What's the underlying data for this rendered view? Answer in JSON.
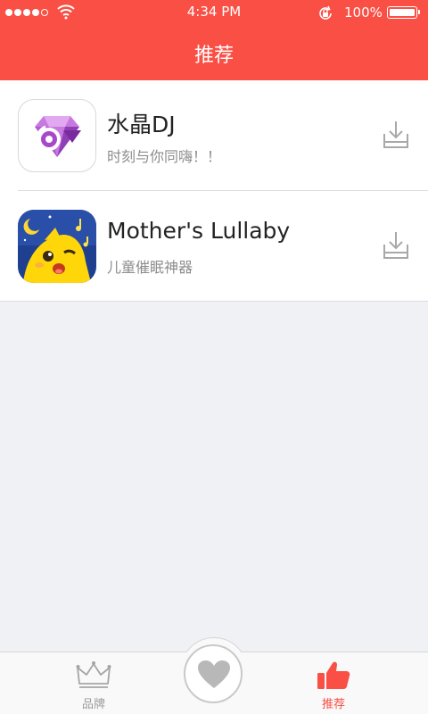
{
  "status_bar": {
    "time": "4:34 PM",
    "battery": "100%",
    "battery_level": 1.0,
    "signal_bars_filled": 4,
    "signal_bars_total": 5,
    "wifi_icon": "wifi-icon",
    "rotation_lock_icon": "rotation-lock-icon"
  },
  "nav": {
    "title": "推荐"
  },
  "apps": [
    {
      "name": "水晶DJ",
      "description": "时刻与你同嗨！！",
      "icon": "crystal-dj-icon",
      "action_icon": "download-icon"
    },
    {
      "name": "Mother's Lullaby",
      "description": "儿童催眠神器",
      "icon": "mothers-lullaby-icon",
      "action_icon": "download-icon"
    }
  ],
  "tab_bar": {
    "tabs": [
      {
        "label": "品牌",
        "icon": "crown-icon",
        "active": false
      },
      {
        "label": "推荐",
        "icon": "thumbs-up-icon",
        "active": true
      }
    ],
    "center_button_icon": "heart-icon"
  },
  "colors": {
    "accent": "#f94f44",
    "background": "#f0f1f5",
    "inactive_tab": "#9a9a9a",
    "secondary_text": "#8c8c8c"
  }
}
